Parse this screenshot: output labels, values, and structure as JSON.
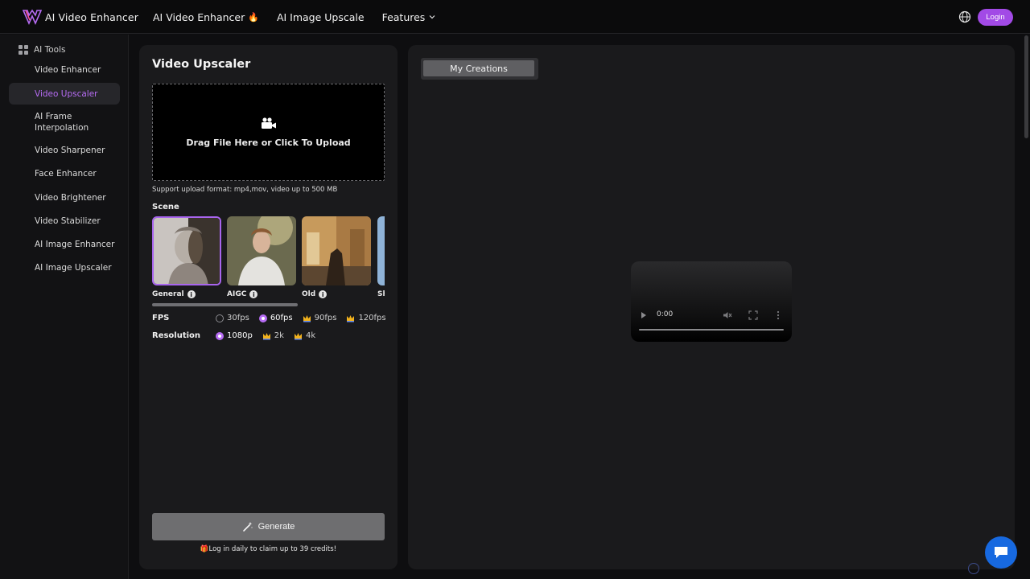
{
  "header": {
    "logo_text": "AI Video Enhancer",
    "nav": [
      {
        "label": "AI Video Enhancer",
        "badge": "🔥"
      },
      {
        "label": "AI Image Upscale"
      },
      {
        "label": "Features"
      }
    ],
    "login_label": "Login",
    "accent_color": "#a24ae6"
  },
  "sidebar": {
    "heading": "AI Tools",
    "items": [
      {
        "label": "Video Enhancer",
        "active": false
      },
      {
        "label": "Video Upscaler",
        "active": true
      },
      {
        "label": "AI Frame Interpolation",
        "active": false
      },
      {
        "label": "Video Sharpener",
        "active": false
      },
      {
        "label": "Face Enhancer",
        "active": false
      },
      {
        "label": "Video Brightener",
        "active": false
      },
      {
        "label": "Video Stabilizer",
        "active": false
      },
      {
        "label": "AI Image Enhancer",
        "active": false
      },
      {
        "label": "AI Image Upscaler",
        "active": false
      }
    ]
  },
  "upscaler": {
    "title": "Video Upscaler",
    "drop_text": "Drag File Here or Click To Upload",
    "support_text": "Support upload format: mp4,mov, video up to 500 MB",
    "scene_label": "Scene",
    "scenes": [
      {
        "name": "General",
        "selected": true
      },
      {
        "name": "AIGC",
        "selected": false
      },
      {
        "name": "Old",
        "selected": false
      },
      {
        "name": "Sh",
        "selected": false
      }
    ],
    "fps": {
      "label": "FPS",
      "options": [
        {
          "label": "30fps",
          "selected": false,
          "premium": false
        },
        {
          "label": "60fps",
          "selected": true,
          "premium": false
        },
        {
          "label": "90fps",
          "selected": false,
          "premium": true
        },
        {
          "label": "120fps",
          "selected": false,
          "premium": true
        }
      ]
    },
    "resolution": {
      "label": "Resolution",
      "options": [
        {
          "label": "1080p",
          "selected": true,
          "premium": false
        },
        {
          "label": "2k",
          "selected": false,
          "premium": true
        },
        {
          "label": "4k",
          "selected": false,
          "premium": true
        }
      ]
    },
    "generate_label": "Generate",
    "daily_text": "Log in daily to claim up to 39 credits!",
    "daily_badge": "🎁"
  },
  "creations": {
    "tab_label": "My Creations",
    "video_time": "0:00"
  }
}
